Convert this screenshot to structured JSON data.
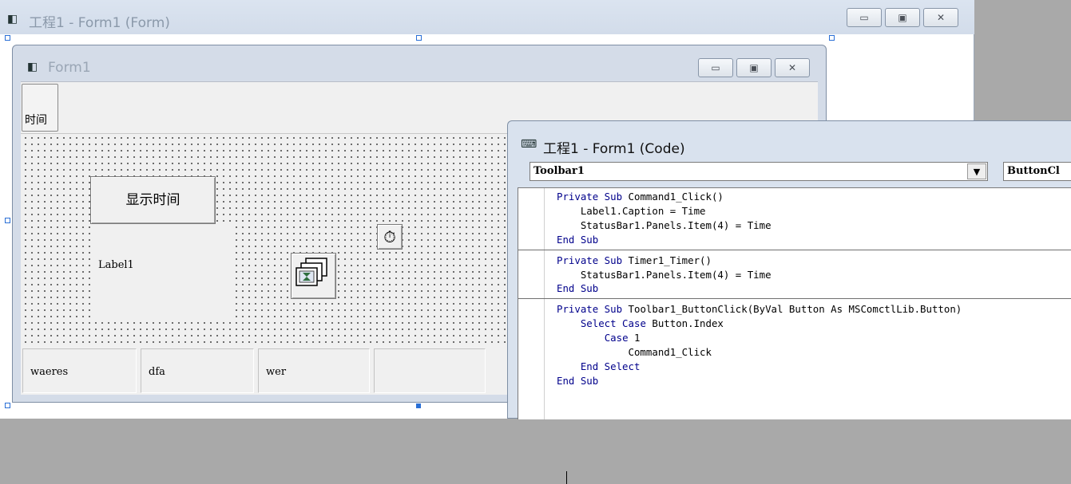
{
  "project_window": {
    "title": "工程1 - Form1 (Form)",
    "caption_buttons": [
      "minimize-icon",
      "restore-icon",
      "close-icon"
    ]
  },
  "form1_window": {
    "title": "Form1",
    "toolbar_button_label": "时间",
    "command_button_label": "显示时间",
    "label1_caption": "Label1",
    "timer_icon": "stopwatch-icon",
    "imagelist_icon": "image-list-icon",
    "status_panels": [
      "waeres",
      "dfa",
      "wer",
      ""
    ]
  },
  "code_window": {
    "title": "工程1 - Form1 (Code)",
    "object_combo": "Toolbar1",
    "procedure_combo": "ButtonCl",
    "procedures": [
      {
        "lines": [
          {
            "kw": "Private Sub",
            "text": " Command1_Click()"
          },
          {
            "text": "    Label1.Caption = Time"
          },
          {
            "text": "    StatusBar1.Panels.Item(4) = Time"
          },
          {
            "kw": "End Sub",
            "text": ""
          }
        ]
      },
      {
        "lines": [
          {
            "kw": "Private Sub",
            "text": " Timer1_Timer()"
          },
          {
            "text": "    StatusBar1.Panels.Item(4) = Time"
          },
          {
            "kw": "End Sub",
            "text": ""
          }
        ]
      },
      {
        "lines": [
          {
            "kw": "Private Sub",
            "text": " Toolbar1_ButtonClick(ByVal Button As MSComctlLib.Button)"
          },
          {
            "text": "    ",
            "kw2": "Select Case",
            "tail": " Button.Index"
          },
          {
            "text": "        ",
            "kw2": "Case",
            "tail": " 1"
          },
          {
            "text": "            Command1_Click"
          },
          {
            "text": "    ",
            "kw2": "End Select",
            "tail": ""
          },
          {
            "kw": "End Sub",
            "text": ""
          }
        ]
      }
    ]
  },
  "colors": {
    "title_bar": "#d2dcea",
    "form_grid_bg": "#f0f0f0",
    "vb_keyword": "#00008b"
  }
}
